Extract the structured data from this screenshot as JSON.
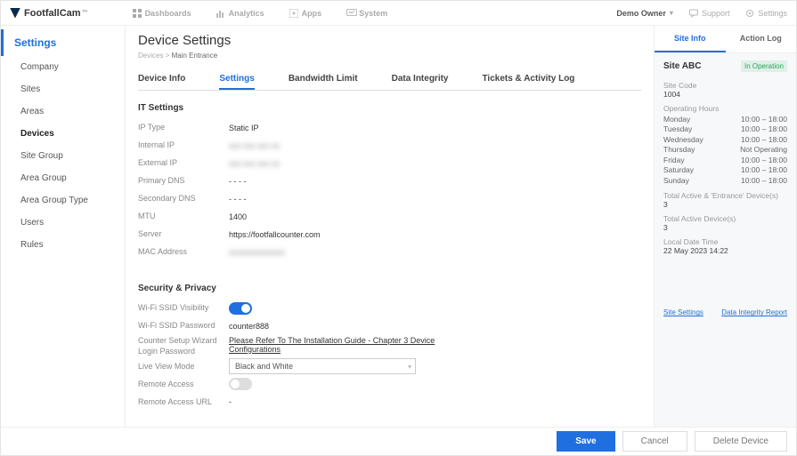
{
  "brand": {
    "name": "FootfallCam",
    "tm": "™"
  },
  "topnav": {
    "dashboards": "Dashboards",
    "analytics": "Analytics",
    "apps": "Apps",
    "system": "System"
  },
  "topright": {
    "owner": "Demo Owner",
    "support": "Support",
    "settings": "Settings"
  },
  "sidebar": {
    "heading": "Settings",
    "items": [
      "Company",
      "Sites",
      "Areas",
      "Devices",
      "Site Group",
      "Area Group",
      "Area Group Type",
      "Users",
      "Rules"
    ]
  },
  "page": {
    "title": "Device Settings",
    "crumb_root": "Devices",
    "crumb_sep": ">",
    "crumb_current": "Main Entrance"
  },
  "tabs": [
    "Device Info",
    "Settings",
    "Bandwidth Limit",
    "Data Integrity",
    "Tickets & Activity Log"
  ],
  "it": {
    "section": "IT Settings",
    "ip_type_k": "IP Type",
    "ip_type_v": "Static IP",
    "internal_ip_k": "Internal IP",
    "internal_ip_v": "xxx xxx xxx xx",
    "external_ip_k": "External IP",
    "external_ip_v": "xxx xxx xxx xx",
    "primary_dns_k": "Primary DNS",
    "primary_dns_v": "- - - -",
    "secondary_dns_k": "Secondary DNS",
    "secondary_dns_v": "- - - -",
    "mtu_k": "MTU",
    "mtu_v": "1400",
    "server_k": "Server",
    "server_v": "https://footfallcounter.com",
    "mac_k": "MAC Address",
    "mac_v": "xxxxxxxxxxxxxx"
  },
  "sec": {
    "section": "Security & Privacy",
    "wifi_vis_k": "Wi-Fi SSID Visibility",
    "wifi_pwd_k": "Wi-Fi SSID Password",
    "wifi_pwd_v": "counter888",
    "wizard_k": "Counter Setup Wizard Login Password",
    "wizard_link": "Please Refer To The Installation Guide - Chapter 3 Device Configurations",
    "liveview_k": "Live View Mode",
    "liveview_v": "Black and White",
    "remote_k": "Remote Access",
    "remote_url_k": "Remote Access URL",
    "remote_url_v": "-"
  },
  "right": {
    "tab_site": "Site Info",
    "tab_action": "Action Log",
    "site_name": "Site ABC",
    "badge": "In Operation",
    "site_code_k": "Site Code",
    "site_code_v": "1004",
    "hours_k": "Operating Hours",
    "hours": [
      {
        "d": "Monday",
        "h": "10:00 – 18:00"
      },
      {
        "d": "Tuesday",
        "h": "10:00 – 18:00"
      },
      {
        "d": "Wednesday",
        "h": "10:00 – 18:00"
      },
      {
        "d": "Thursday",
        "h": "Not Operating"
      },
      {
        "d": "Friday",
        "h": "10:00 – 18:00"
      },
      {
        "d": "Saturday",
        "h": "10:00 – 18:00"
      },
      {
        "d": "Sunday",
        "h": "10:00 – 18:00"
      }
    ],
    "active_entrance_k": "Total Active  & 'Entrance' Device(s)",
    "active_entrance_v": "3",
    "active_k": "Total Active Device(s)",
    "active_v": "3",
    "localtime_k": "Local Date Time",
    "localtime_v": "22 May 2023  14:22",
    "link_site": "Site Settings",
    "link_integrity": "Data Integrity Report"
  },
  "footer": {
    "save": "Save",
    "cancel": "Cancel",
    "del": "Delete Device"
  }
}
